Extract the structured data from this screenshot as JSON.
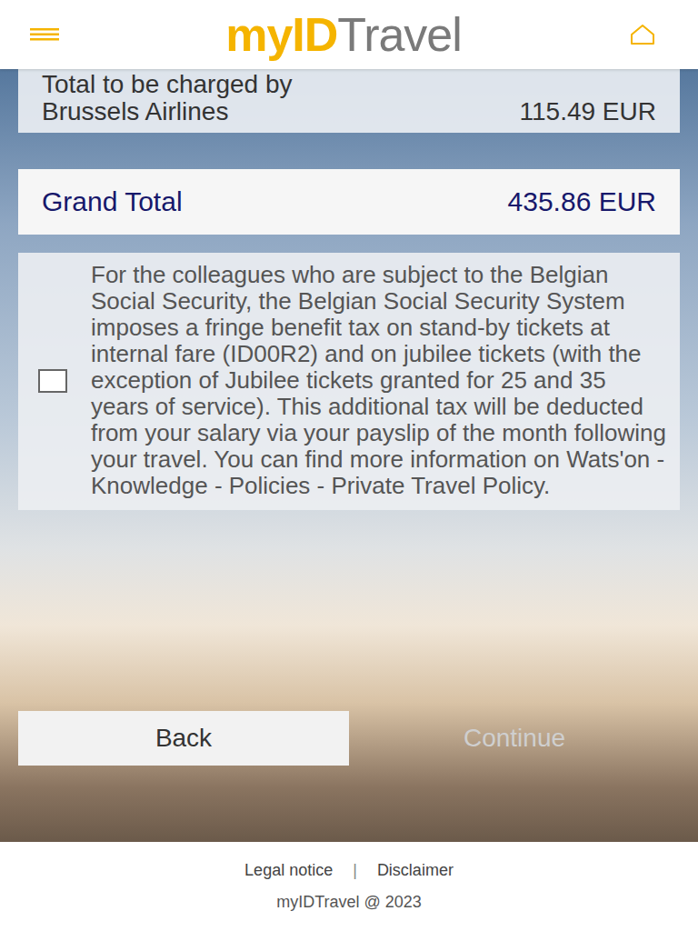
{
  "header": {
    "logo": {
      "brand": "myID",
      "suffix": "Travel"
    }
  },
  "summary": {
    "label_lines": [
      "Total to be charged by",
      "Brussels Airlines"
    ],
    "amount": "115.49 EUR"
  },
  "grand_total": {
    "label": "Grand Total",
    "amount": "435.86 EUR"
  },
  "notice": {
    "checked": false,
    "text": "For the colleagues who are subject to the Belgian Social Security, the Belgian Social Security System imposes a fringe benefit tax on stand-by tickets at internal fare (ID00R2) and on jubilee tickets (with the exception of Jubilee tickets granted for 25 and 35 years of service). This additional tax will be deducted from your salary via your payslip of the month following your travel. You can find more information on Wats'on - Knowledge - Policies - Private Travel Policy."
  },
  "buttons": [
    {
      "label": "Back",
      "disabled": false
    },
    {
      "label": "Continue",
      "disabled": true
    }
  ],
  "footer": {
    "links": [
      "Legal notice",
      "Disclaimer"
    ],
    "separator": "|",
    "copyright": "myIDTravel @ 2023"
  }
}
